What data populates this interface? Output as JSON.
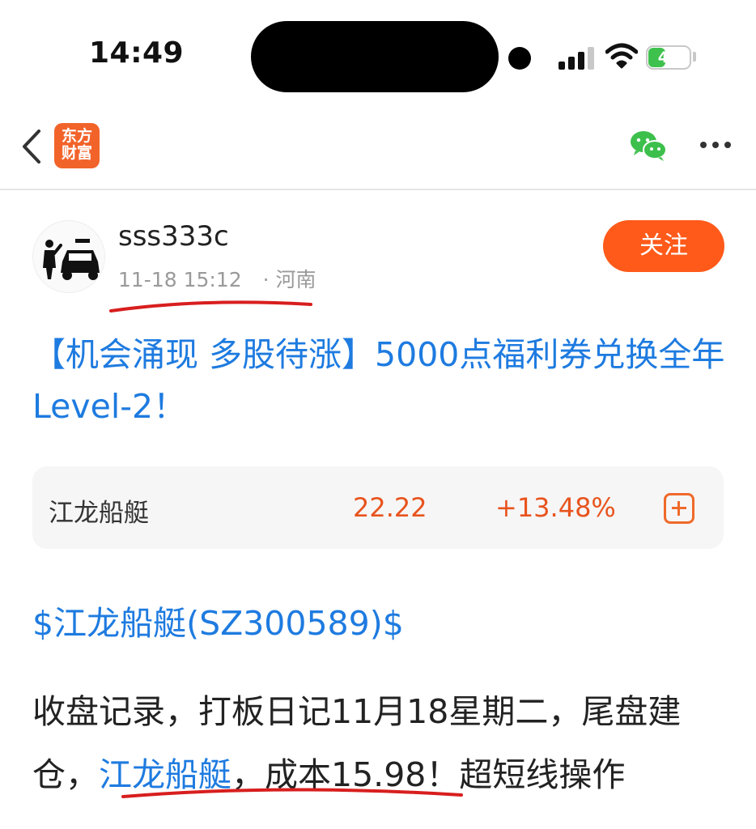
{
  "status_bar": {
    "time": "14:49",
    "battery": "41"
  },
  "nav": {
    "app_logo_line1": "东方",
    "app_logo_line2": "财富",
    "brand_color": "#f2632a"
  },
  "author": {
    "username": "sss333c",
    "datetime": "11-18 15:12",
    "location": "· 河南",
    "follow_label": "关注"
  },
  "post": {
    "title": "【机会涌现 多股待涨】5000点福利券兑换全年Level-2！",
    "stock_tag": "$江龙船艇(SZ300589)$",
    "body_part1": "收盘记录，打板日记11月18星期二，尾盘建仓，",
    "body_link": "江龙船艇",
    "body_part2": "，成本15.98！超短线操作"
  },
  "stock_card": {
    "name": "江龙船艇",
    "price": "22.22",
    "change": "+13.48%"
  },
  "colors": {
    "link": "#1e7be0",
    "up": "#e8541e",
    "follow": "#ff5a1a",
    "annotation": "#d81e1e"
  }
}
